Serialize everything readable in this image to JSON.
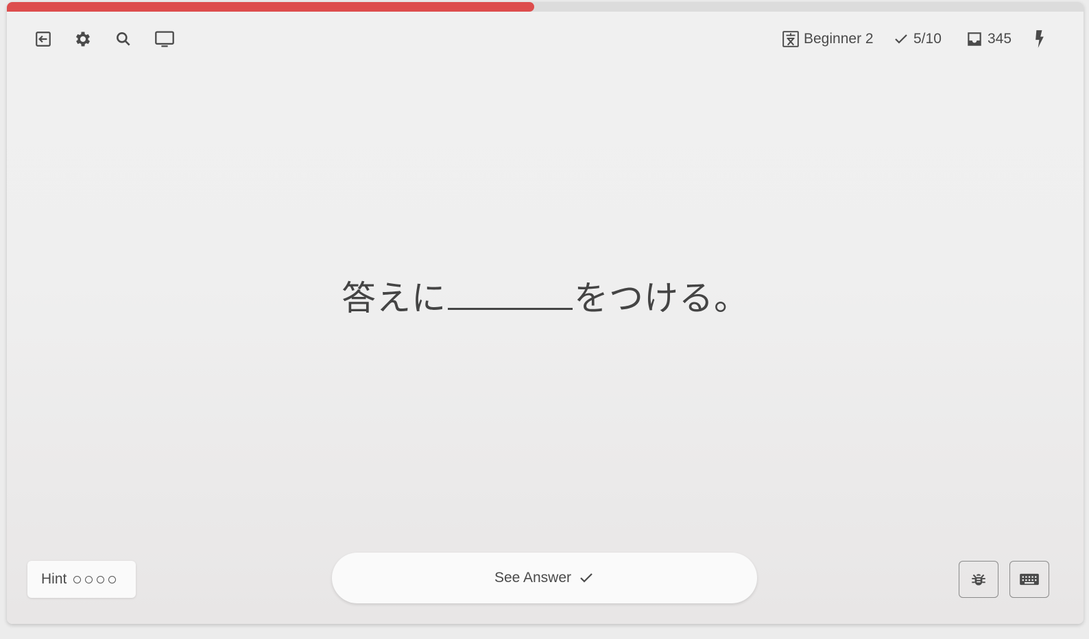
{
  "progress": {
    "fraction": 0.49,
    "color": "#dd4d4d"
  },
  "toolbar": {
    "icons": [
      "exit-icon",
      "gear-icon",
      "search-icon",
      "monitor-icon"
    ]
  },
  "stats": {
    "level": "Beginner 2",
    "score": "5/10",
    "count": "345"
  },
  "question": {
    "before": "答えに",
    "after": "をつける。"
  },
  "hint": {
    "label": "Hint",
    "dots": 4
  },
  "answer_button": {
    "label": "See Answer"
  },
  "bottom_right": {
    "icons": [
      "bug-icon",
      "keyboard-icon"
    ]
  }
}
